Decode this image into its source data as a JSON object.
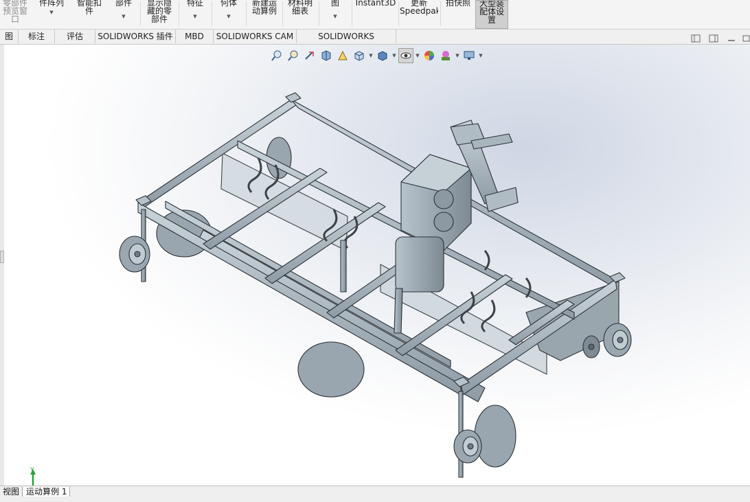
{
  "ribbon": {
    "buttons": [
      {
        "id": "preview-window",
        "l1": "零部件",
        "l2": "预览窗",
        "l3": "口",
        "gray": true
      },
      {
        "id": "linear-pattern",
        "l1": "件阵列",
        "l2": "",
        "l3": ""
      },
      {
        "id": "smart-fasteners",
        "l1": "智能扣",
        "l2": "件",
        "l3": ""
      },
      {
        "id": "component",
        "l1": "部件",
        "l2": "",
        "l3": ""
      },
      {
        "id": "show-hidden",
        "l1": "显示隐",
        "l2": "藏的零",
        "l3": "部件"
      },
      {
        "id": "assembly-features",
        "l1": "特征",
        "l2": "",
        "l3": ""
      },
      {
        "id": "reference-geometry",
        "l1": "何体",
        "l2": "",
        "l3": ""
      },
      {
        "id": "new-motion-study",
        "l1": "新建运",
        "l2": "动算例",
        "l3": ""
      },
      {
        "id": "bom",
        "l1": "材料明",
        "l2": "细表",
        "l3": ""
      },
      {
        "id": "exploded-view",
        "l1": "图",
        "l2": "",
        "l3": ""
      },
      {
        "id": "instant3d",
        "l1": "Instant3D",
        "l2": "",
        "l3": ""
      },
      {
        "id": "update-speedpak",
        "l1": "更新",
        "l2": "Speedpak",
        "l3": ""
      },
      {
        "id": "take-snapshot",
        "l1": "拍快照",
        "l2": "",
        "l3": ""
      },
      {
        "id": "large-assembly",
        "l1": "大型装",
        "l2": "配体设",
        "l3": "置"
      }
    ]
  },
  "tabs": [
    {
      "label": "图"
    },
    {
      "label": "标注"
    },
    {
      "label": "评估"
    },
    {
      "label": "SOLIDWORKS 插件"
    },
    {
      "label": "MBD"
    },
    {
      "label": "SOLIDWORKS CAM"
    },
    {
      "label": "SOLIDWORKS Inspection"
    }
  ],
  "statusbar": {
    "tabs": [
      {
        "label": "视图"
      },
      {
        "label": "运动算例 1"
      }
    ]
  },
  "triad": {
    "x": "X",
    "y": "Y",
    "z": "Z"
  },
  "colors": {
    "accent": "#4a7fc1",
    "model": "#aab8c2",
    "edge": "#2d3338"
  }
}
